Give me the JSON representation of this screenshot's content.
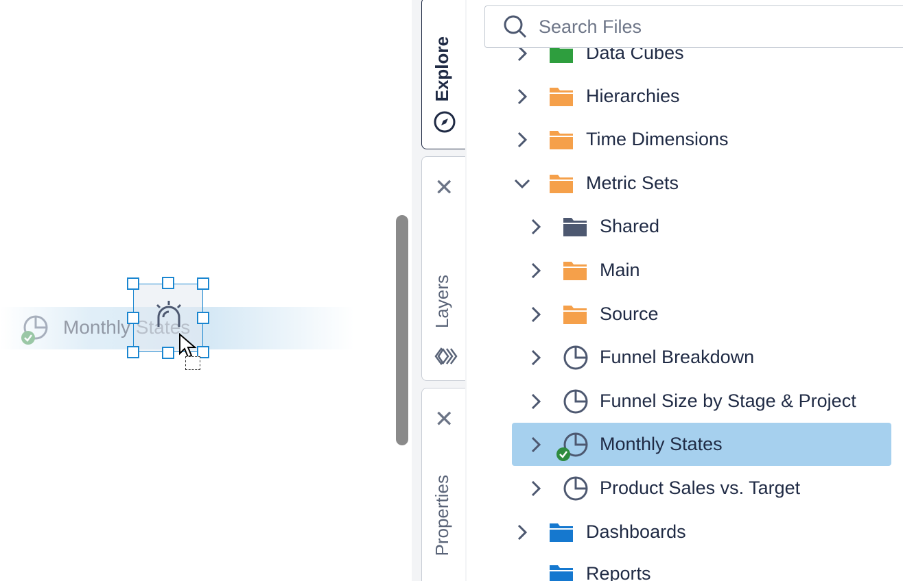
{
  "canvas": {
    "drag_label": "Monthly States"
  },
  "tabs": {
    "explore": "Explore",
    "layers": "Layers",
    "properties": "Properties"
  },
  "search": {
    "placeholder": "Search Files"
  },
  "tree": {
    "items": [
      {
        "label": "Data Cubes",
        "icon": "folder-green-icon",
        "expanded": false
      },
      {
        "label": "Hierarchies",
        "icon": "folder-orange-icon",
        "expanded": false
      },
      {
        "label": "Time Dimensions",
        "icon": "folder-orange-icon",
        "expanded": false
      },
      {
        "label": "Metric Sets",
        "icon": "folder-orange-open-icon",
        "expanded": true
      },
      {
        "label": "Shared",
        "icon": "folder-gray-icon",
        "expanded": false
      },
      {
        "label": "Main",
        "icon": "folder-orange-icon",
        "expanded": false
      },
      {
        "label": "Source",
        "icon": "folder-orange-icon",
        "expanded": false
      },
      {
        "label": "Funnel Breakdown",
        "icon": "metric-set-icon",
        "expanded": false
      },
      {
        "label": "Funnel Size by Stage & Project",
        "icon": "metric-set-icon",
        "expanded": false
      },
      {
        "label": "Monthly States",
        "icon": "metric-set-icon",
        "expanded": false,
        "selected": true
      },
      {
        "label": "Product Sales vs. Target",
        "icon": "metric-set-icon",
        "expanded": false
      },
      {
        "label": "Dashboards",
        "icon": "folder-blue-icon",
        "expanded": false
      },
      {
        "label": "Reports",
        "icon": "folder-blue-icon",
        "expanded": false
      }
    ]
  },
  "colors": {
    "selection_blue": "#1a86d0",
    "selected_row": "#a6d0ee",
    "folder_orange": "#f5a04a",
    "folder_blue": "#1578cf",
    "folder_green": "#2e9e3e",
    "folder_gray": "#4d5870",
    "check_green": "#2e8b3e"
  }
}
